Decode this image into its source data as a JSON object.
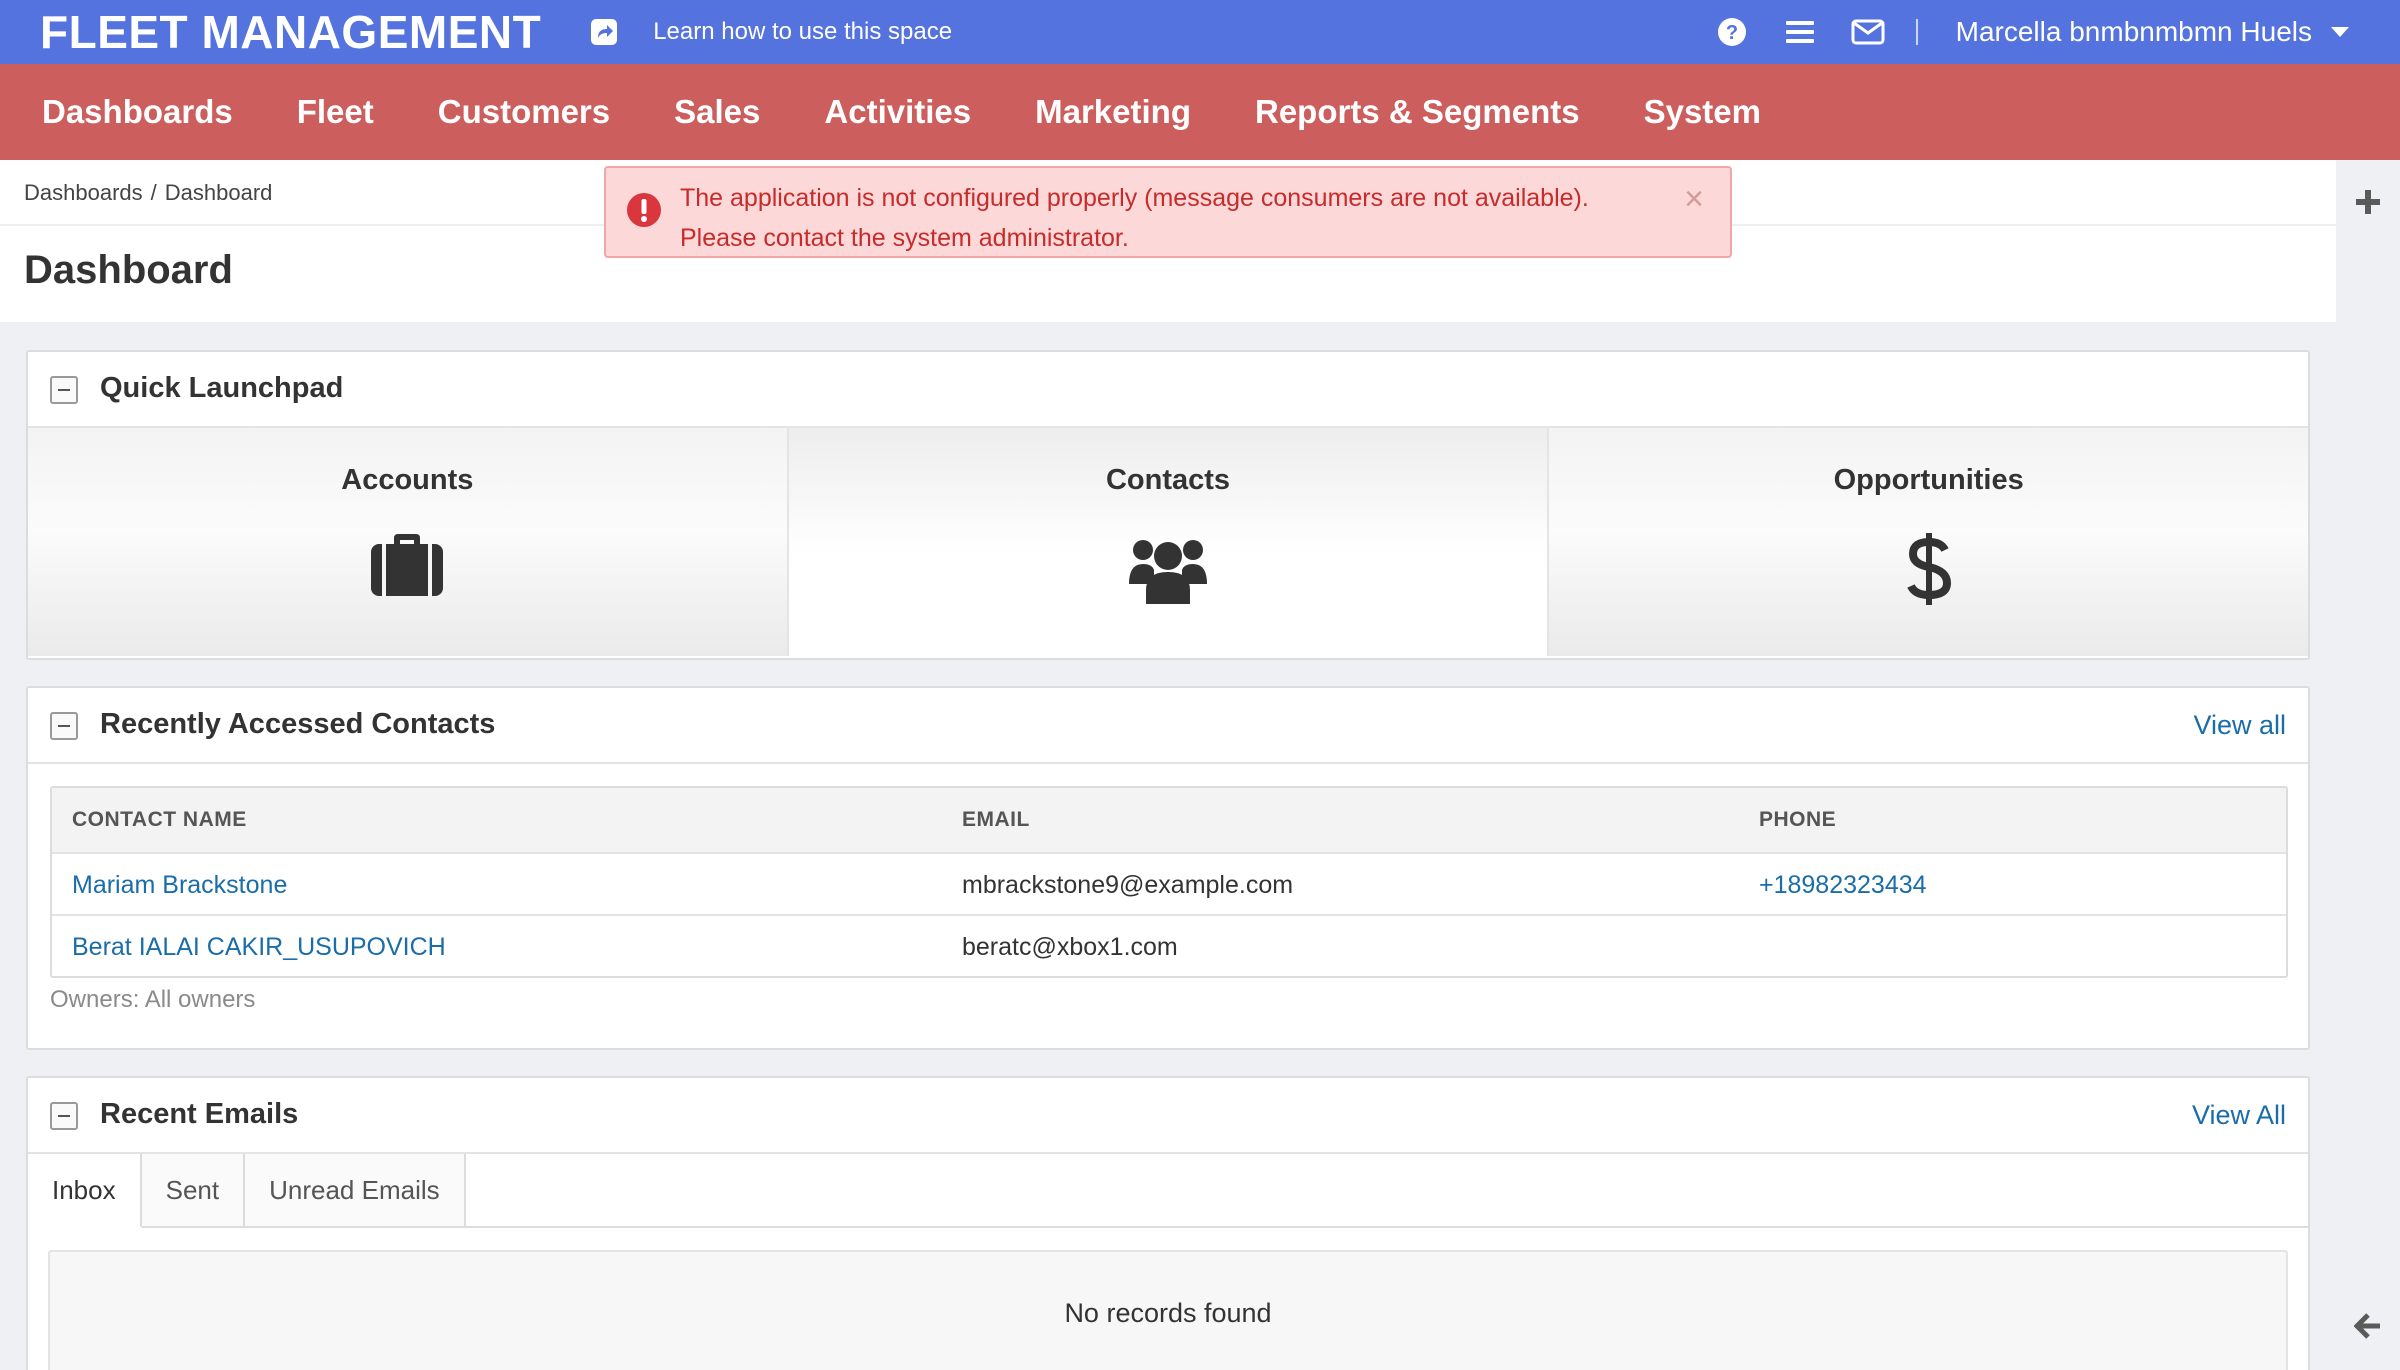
{
  "header": {
    "brand": "FLEET MANAGEMENT",
    "learn_link": "Learn how to use this space",
    "user_name": "Marcella bnmbnmbmn Huels",
    "icons": [
      "share-icon",
      "help-icon",
      "menu-icon",
      "mail-icon",
      "caret-down-icon"
    ],
    "colors": {
      "topbar": "#5573de",
      "nav": "#cc5e5e"
    }
  },
  "nav": {
    "items": [
      "Dashboards",
      "Fleet",
      "Customers",
      "Sales",
      "Activities",
      "Marketing",
      "Reports & Segments",
      "System"
    ]
  },
  "breadcrumb": {
    "root": "Dashboards",
    "separator": "/",
    "current": "Dashboard"
  },
  "page": {
    "title": "Dashboard"
  },
  "alert": {
    "line1": "The application is not configured properly (message consumers are not available).",
    "line2": "Please contact the system administrator.",
    "close": "×",
    "color": "#c72b2b"
  },
  "launchpad": {
    "title": "Quick Launchpad",
    "items": [
      {
        "label": "Accounts",
        "icon": "briefcase-icon"
      },
      {
        "label": "Contacts",
        "icon": "users-icon"
      },
      {
        "label": "Opportunities",
        "icon": "dollar-icon"
      }
    ]
  },
  "contacts": {
    "title": "Recently Accessed Contacts",
    "view_all": "View all",
    "columns": [
      "CONTACT NAME",
      "EMAIL",
      "PHONE"
    ],
    "rows": [
      {
        "name": "Mariam Brackstone",
        "email": "mbrackstone9@example.com",
        "phone": "+18982323434"
      },
      {
        "name": "Berat IALAI CAKIR_USUPOVICH",
        "email": "beratc@xbox1.com",
        "phone": ""
      }
    ],
    "owners": "Owners: All owners"
  },
  "emails": {
    "title": "Recent Emails",
    "view_all": "View All",
    "tabs": [
      "Inbox",
      "Sent",
      "Unread Emails"
    ],
    "active_tab": "Inbox",
    "empty": "No records found"
  }
}
